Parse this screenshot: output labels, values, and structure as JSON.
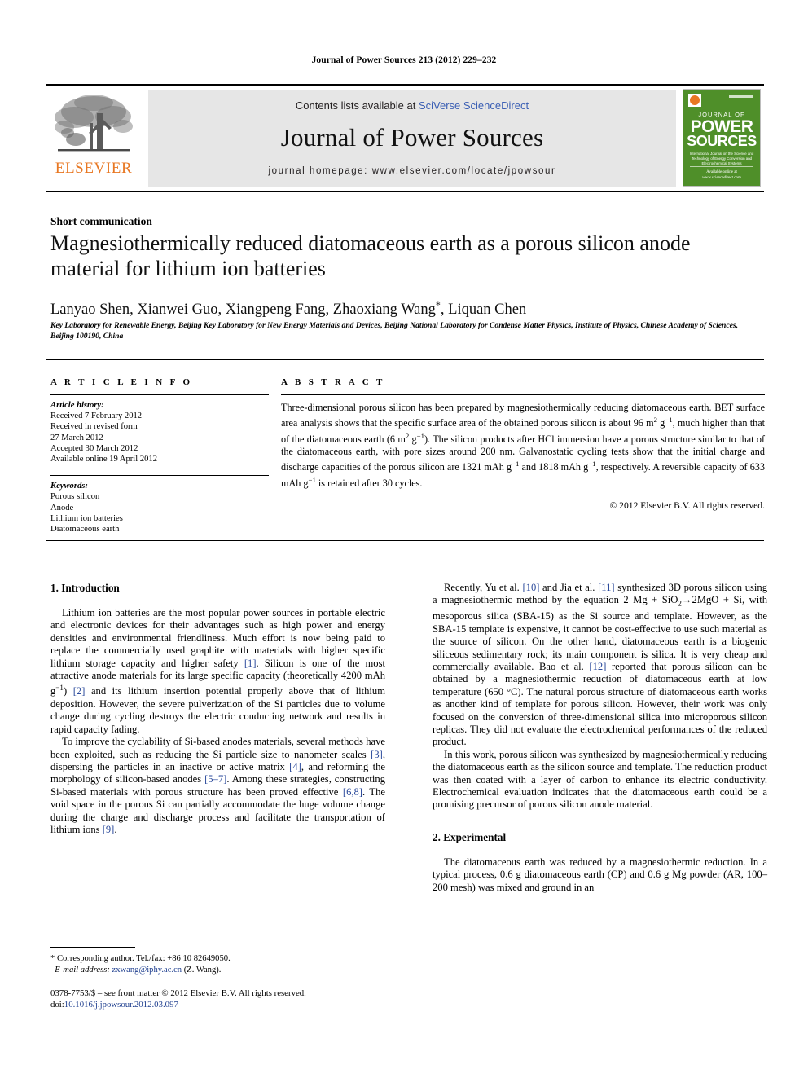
{
  "running_head": "Journal of Power Sources 213 (2012) 229–232",
  "masthead": {
    "publisher_name": "ELSEVIER",
    "publisher_logo_alt": "elsevier-tree-logo",
    "contents_prefix": "Contents lists available at ",
    "contents_link": "SciVerse ScienceDirect",
    "journal_title": "Journal of Power Sources",
    "homepage_line": "journal homepage: www.elsevier.com/locate/jpowsour",
    "cover": {
      "kicker": "JOURNAL OF",
      "word1": "POWER",
      "word2": "SOURCES",
      "subtitle": "International Journal on the Science and Technology of Energy Conversion and Electrochemical Systems",
      "footer": "Available online at www.sciencedirect.com"
    }
  },
  "article": {
    "category": "Short communication",
    "title": "Magnesiothermically reduced diatomaceous earth as a porous silicon anode material for lithium ion batteries",
    "authors": "Lanyao Shen, Xianwei Guo, Xiangpeng Fang, Zhaoxiang Wang",
    "authors_star": "*",
    "authors_tail": ", Liquan Chen",
    "affiliation": "Key Laboratory for Renewable Energy, Beijing Key Laboratory for New Energy Materials and Devices, Beijing National Laboratory for Condense Matter Physics, Institute of Physics, Chinese Academy of Sciences, Beijing 100190, China"
  },
  "article_info": {
    "heading": "A R T I C L E   I N F O",
    "history_label": "Article history:",
    "history": [
      "Received 7 February 2012",
      "Received in revised form",
      "27 March 2012",
      "Accepted 30 March 2012",
      "Available online 19 April 2012"
    ],
    "keywords_label": "Keywords:",
    "keywords": [
      "Porous silicon",
      "Anode",
      "Lithium ion batteries",
      "Diatomaceous earth"
    ]
  },
  "abstract": {
    "heading": "A B S T R A C T",
    "text": "Three-dimensional porous silicon has been prepared by magnesiothermically reducing diatomaceous earth. BET surface area analysis shows that the specific surface area of the obtained porous silicon is about 96 m2 g−1, much higher than that of the diatomaceous earth (6 m2 g−1). The silicon products after HCl immersion have a porous structure similar to that of the diatomaceous earth, with pore sizes around 200 nm. Galvanostatic cycling tests show that the initial charge and discharge capacities of the porous silicon are 1321 mAh g−1 and 1818 mAh g−1, respectively. A reversible capacity of 633 mAh g−1 is retained after 30 cycles.",
    "copyright": "© 2012 Elsevier B.V. All rights reserved."
  },
  "sections": {
    "intro_heading": "1.  Introduction",
    "intro_p1": "Lithium ion batteries are the most popular power sources in portable electric and electronic devices for their advantages such as high power and energy densities and environmental friendliness. Much effort is now being paid to replace the commercially used graphite with materials with higher specific lithium storage capacity and higher safety [1]. Silicon is one of the most attractive anode materials for its large specific capacity (theoretically 4200 mAh g−1) [2] and its lithium insertion potential properly above that of lithium deposition. However, the severe pulverization of the Si particles due to volume change during cycling destroys the electric conducting network and results in rapid capacity fading.",
    "intro_p2": "To improve the cyclability of Si-based anodes materials, several methods have been exploited, such as reducing the Si particle size to nanometer scales [3], dispersing the particles in an inactive or active matrix [4], and reforming the morphology of silicon-based anodes [5–7]. Among these strategies, constructing Si-based materials with porous structure has been proved effective [6,8]. The void space in the porous Si can partially accommodate the huge volume change during the charge and discharge process and facilitate the transportation of lithium ions [9].",
    "intro_p3": "Recently, Yu et al. [10] and Jia et al. [11] synthesized 3D porous silicon using a magnesiothermic method by the equation 2 Mg + SiO2→2MgO + Si, with mesoporous silica (SBA-15) as the Si source and template. However, as the SBA-15 template is expensive, it cannot be cost-effective to use such material as the source of silicon. On the other hand, diatomaceous earth is a biogenic siliceous sedimentary rock; its main component is silica. It is very cheap and commercially available. Bao et al. [12] reported that porous silicon can be obtained by a magnesiothermic reduction of diatomaceous earth at low temperature (650 °C). The natural porous structure of diatomaceous earth works as another kind of template for porous silicon. However, their work was only focused on the conversion of three-dimensional silica into microporous silicon replicas. They did not evaluate the electrochemical performances of the reduced product.",
    "intro_p4": "In this work, porous silicon was synthesized by magnesiothermically reducing the diatomaceous earth as the silicon source and template. The reduction product was then coated with a layer of carbon to enhance its electric conductivity. Electrochemical evaluation indicates that the diatomaceous earth could be a promising precursor of porous silicon anode material.",
    "experimental_heading": "2.  Experimental",
    "exp_p1": "The diatomaceous earth was reduced by a magnesiothermic reduction. In a typical process, 0.6 g diatomaceous earth (CP) and 0.6 g Mg powder (AR, 100–200 mesh) was mixed and ground in an"
  },
  "footnotes": {
    "corresponding": "* Corresponding author. Tel./fax: +86 10 82649050.",
    "email_label": "E-mail address:",
    "email": "zxwang@iphy.ac.cn",
    "email_tail": " (Z. Wang).",
    "imprint_line1": "0378-7753/$ – see front matter © 2012 Elsevier B.V. All rights reserved.",
    "doi_label": "doi:",
    "doi": "10.1016/j.jpowsour.2012.03.097"
  },
  "colors": {
    "elsevier_orange": "#E87722",
    "link_blue": "#3b5fb4",
    "ref_blue": "#2b4a9b",
    "cover_green": "#4f8f29",
    "masthead_gray": "#e6e6e6"
  }
}
